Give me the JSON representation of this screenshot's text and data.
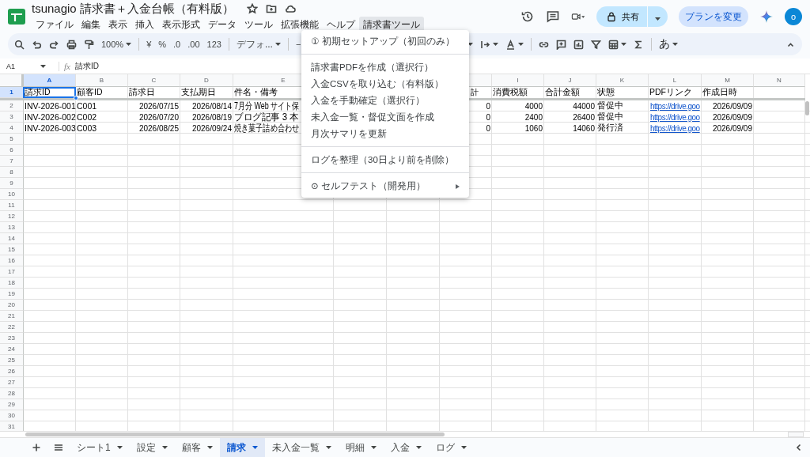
{
  "document": {
    "title": "tsunagio 請求書＋入金台帳（有料版）"
  },
  "menu_bar": [
    {
      "label": "ファイル",
      "selected": false
    },
    {
      "label": "編集",
      "selected": false
    },
    {
      "label": "表示",
      "selected": false
    },
    {
      "label": "挿入",
      "selected": false
    },
    {
      "label": "表示形式",
      "selected": false
    },
    {
      "label": "データ",
      "selected": false
    },
    {
      "label": "ツール",
      "selected": false
    },
    {
      "label": "拡張機能",
      "selected": false
    },
    {
      "label": "ヘルプ",
      "selected": false
    },
    {
      "label": "請求書ツール",
      "selected": true
    }
  ],
  "header_actions": {
    "share": "共有",
    "plan": "プランを変更",
    "avatar": "o"
  },
  "toolbar": {
    "zoom": "100%",
    "currency": "¥",
    "percent": "%",
    "decrease_decimal": ".0",
    "increase_decimal": ".00",
    "number_format": "123",
    "font": "デフォ...",
    "font_size_minus": "−",
    "input_mode": "あ"
  },
  "formula_bar": {
    "cell": "A1",
    "fx": "fx",
    "value": "請求ID"
  },
  "sheet": {
    "columns": [
      {
        "kind": "letter",
        "label": "A",
        "selected": true
      },
      {
        "kind": "letter",
        "label": "B",
        "selected": false
      },
      {
        "kind": "letter",
        "label": "C",
        "selected": false
      },
      {
        "kind": "letter",
        "label": "D",
        "selected": false
      },
      {
        "kind": "letter",
        "label": "E",
        "selected": false
      },
      {
        "kind": "covered"
      },
      {
        "kind": "covered"
      },
      {
        "kind": "partly_covered"
      },
      {
        "kind": "letter",
        "label": "I",
        "selected": false
      },
      {
        "kind": "letter",
        "label": "J",
        "selected": false
      },
      {
        "kind": "letter",
        "label": "K",
        "selected": false
      },
      {
        "kind": "letter",
        "label": "L",
        "selected": false
      },
      {
        "kind": "letter",
        "label": "M",
        "selected": false
      },
      {
        "kind": "letter",
        "label": "N",
        "selected": false
      }
    ],
    "rows": [
      {
        "number": "1",
        "selected": true,
        "cells": {
          "A": {
            "text": "請求ID",
            "kind": "text",
            "selected": true
          },
          "B": {
            "text": "顧客ID",
            "kind": "text",
            "selected": false
          },
          "C": {
            "text": "請求日",
            "kind": "text",
            "selected": false
          },
          "D": {
            "text": "支払期日",
            "kind": "text",
            "selected": false
          },
          "E": {
            "text": "件名・備考",
            "kind": "text",
            "selected": false
          },
          "H": {
            "text": "計",
            "kind": "peek",
            "selected": false
          },
          "I": {
            "text": "消費税額",
            "kind": "text",
            "selected": false
          },
          "J": {
            "text": "合計金額",
            "kind": "text",
            "selected": false
          },
          "K": {
            "text": "状態",
            "kind": "text",
            "selected": false
          },
          "L": {
            "text": "PDFリンク",
            "kind": "text",
            "selected": false
          },
          "M": {
            "text": "作成日時",
            "kind": "text",
            "selected": false
          }
        }
      },
      {
        "number": "2",
        "selected": false,
        "cells": {
          "A": {
            "text": "INV-2026-001",
            "kind": "text",
            "selected": false
          },
          "B": {
            "text": "C001",
            "kind": "text",
            "selected": false
          },
          "C": {
            "text": "2026/07/15",
            "kind": "number",
            "selected": false
          },
          "D": {
            "text": "2026/08/14",
            "kind": "number",
            "selected": false
          },
          "E": {
            "text": "7月分 Web サイト保",
            "kind": "text",
            "selected": false
          },
          "H": {
            "text": "0",
            "kind": "number",
            "selected": false
          },
          "I": {
            "text": "4000",
            "kind": "number",
            "selected": false
          },
          "J": {
            "text": "44000",
            "kind": "number",
            "selected": false
          },
          "K": {
            "text": "督促中",
            "kind": "text",
            "selected": false
          },
          "L": {
            "text": "https://drive.goo",
            "kind": "link",
            "selected": false
          },
          "M": {
            "text": "2026/09/09",
            "kind": "number",
            "selected": false
          }
        }
      },
      {
        "number": "3",
        "selected": false,
        "cells": {
          "A": {
            "text": "INV-2026-002",
            "kind": "text",
            "selected": false
          },
          "B": {
            "text": "C002",
            "kind": "text",
            "selected": false
          },
          "C": {
            "text": "2026/07/20",
            "kind": "number",
            "selected": false
          },
          "D": {
            "text": "2026/08/19",
            "kind": "number",
            "selected": false
          },
          "E": {
            "text": "ブログ記事 3 本",
            "kind": "text",
            "selected": false
          },
          "H": {
            "text": "0",
            "kind": "number",
            "selected": false
          },
          "I": {
            "text": "2400",
            "kind": "number",
            "selected": false
          },
          "J": {
            "text": "26400",
            "kind": "number",
            "selected": false
          },
          "K": {
            "text": "督促中",
            "kind": "text",
            "selected": false
          },
          "L": {
            "text": "https://drive.goo",
            "kind": "link",
            "selected": false
          },
          "M": {
            "text": "2026/09/09",
            "kind": "number",
            "selected": false
          }
        }
      },
      {
        "number": "4",
        "selected": false,
        "cells": {
          "A": {
            "text": "INV-2026-003",
            "kind": "text",
            "selected": false
          },
          "B": {
            "text": "C003",
            "kind": "text",
            "selected": false
          },
          "C": {
            "text": "2026/08/25",
            "kind": "number",
            "selected": false
          },
          "D": {
            "text": "2026/09/24",
            "kind": "number",
            "selected": false
          },
          "E": {
            "text": "焼き菓子詰め合わせ",
            "kind": "text",
            "selected": false
          },
          "H": {
            "text": "0",
            "kind": "number",
            "selected": false
          },
          "I": {
            "text": "1060",
            "kind": "number",
            "selected": false
          },
          "J": {
            "text": "14060",
            "kind": "number",
            "selected": false
          },
          "K": {
            "text": "発行済",
            "kind": "text",
            "selected": false
          },
          "L": {
            "text": "https://drive.goo",
            "kind": "link",
            "selected": false
          },
          "M": {
            "text": "2026/09/09",
            "kind": "number",
            "selected": false
          }
        }
      },
      {
        "number": "5",
        "selected": false
      },
      {
        "number": "6",
        "selected": false
      },
      {
        "number": "7",
        "selected": false
      },
      {
        "number": "8",
        "selected": false
      },
      {
        "number": "9",
        "selected": false
      },
      {
        "number": "10",
        "selected": false
      },
      {
        "number": "11",
        "selected": false
      },
      {
        "number": "12",
        "selected": false
      },
      {
        "number": "13",
        "selected": false
      },
      {
        "number": "14",
        "selected": false
      },
      {
        "number": "15",
        "selected": false
      },
      {
        "number": "16",
        "selected": false
      },
      {
        "number": "17",
        "selected": false
      },
      {
        "number": "18",
        "selected": false
      },
      {
        "number": "19",
        "selected": false
      },
      {
        "number": "20",
        "selected": false
      },
      {
        "number": "21",
        "selected": false
      },
      {
        "number": "22",
        "selected": false
      },
      {
        "number": "23",
        "selected": false
      },
      {
        "number": "24",
        "selected": false
      },
      {
        "number": "25",
        "selected": false
      },
      {
        "number": "26",
        "selected": false
      },
      {
        "number": "27",
        "selected": false
      },
      {
        "number": "28",
        "selected": false
      },
      {
        "number": "29",
        "selected": false
      },
      {
        "number": "30",
        "selected": false
      },
      {
        "number": "31",
        "selected": false
      }
    ]
  },
  "dropdown_menu": [
    {
      "kind": "item",
      "label": "① 初期セットアップ（初回のみ）"
    },
    {
      "kind": "separator"
    },
    {
      "kind": "item",
      "label": "請求書PDFを作成（選択行）"
    },
    {
      "kind": "item",
      "label": "入金CSVを取り込む（有料版）"
    },
    {
      "kind": "item",
      "label": "入金を手動確定（選択行）"
    },
    {
      "kind": "item",
      "label": "未入金一覧・督促文面を作成"
    },
    {
      "kind": "item",
      "label": "月次サマリを更新"
    },
    {
      "kind": "separator"
    },
    {
      "kind": "item",
      "label": "ログを整理（30日より前を削除）"
    },
    {
      "kind": "separator"
    },
    {
      "kind": "submenu",
      "label": "⊙ セルフテスト（開発用）"
    }
  ],
  "sheet_tabs": [
    {
      "label": "シート1",
      "selected": false
    },
    {
      "label": "設定",
      "selected": false
    },
    {
      "label": "顧客",
      "selected": false
    },
    {
      "label": "請求",
      "selected": true
    },
    {
      "label": "未入金一覧",
      "selected": false
    },
    {
      "label": "明細",
      "selected": false
    },
    {
      "label": "入金",
      "selected": false
    },
    {
      "label": "ログ",
      "selected": false
    }
  ]
}
